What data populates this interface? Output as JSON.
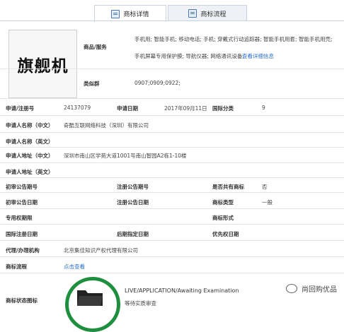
{
  "tabs": [
    {
      "label": "商标详情",
      "active": true
    },
    {
      "label": "商标流程",
      "active": false
    }
  ],
  "logo": {
    "text": "旗舰机"
  },
  "goods_services": {
    "label": "商品/服务",
    "line1": "手机用; 智能手机; 移动电话; 手机; 穿戴式行动追踪器; 智能手机用套; 智能手机用壳;",
    "line2": "手机屏幕专用保护膜; 导航仪器; 网络通讯设备;",
    "more_link": "查看详细信息"
  },
  "similar_group": {
    "label": "类似群",
    "value": "0907;0909;0922;"
  },
  "rows": {
    "reg_no_label": "申请/注册号",
    "reg_no": "24137079",
    "apply_date_label": "申请日期",
    "apply_date": "2017年09月11日",
    "intl_class_label": "国际分类",
    "intl_class": "9",
    "applicant_cn_label": "申请人名称（中文）",
    "applicant_cn": "奇酷互联网络科技（深圳）有限公司",
    "applicant_en_label": "申请人名称（英文）",
    "address_cn_label": "申请人地址（中文）",
    "address_cn": "深圳市南山区学苑大道1001号南山智园A2栋1-10楼",
    "address_en_label": "申请人地址（英文）",
    "prelim_no_label": "初审公告期号",
    "reg_pub_no_label": "注册公告期号",
    "shared_label": "是否共有商标",
    "shared": "否",
    "prelim_date_label": "初审公告日期",
    "reg_pub_date_label": "注册公告日期",
    "type_label": "商标类型",
    "type": "一般",
    "exclusive_label": "专用权期限",
    "form_label": "商标形式",
    "intl_reg_date_label": "国际注册日期",
    "later_date_label": "后期指定日期",
    "priority_date_label": "优先权日期",
    "agent_label": "代理/办理机构",
    "agent": "北京集佳知识产权代理有限公司",
    "process_label": "商标流程",
    "process_link": "点击查看",
    "status_icon_label": "商标状态图标",
    "status_text": "LIVE/APPLICATION/Awaiting Examination",
    "status_sub": "等待实质审查"
  },
  "watermark": {
    "account": "尚回购优品"
  }
}
